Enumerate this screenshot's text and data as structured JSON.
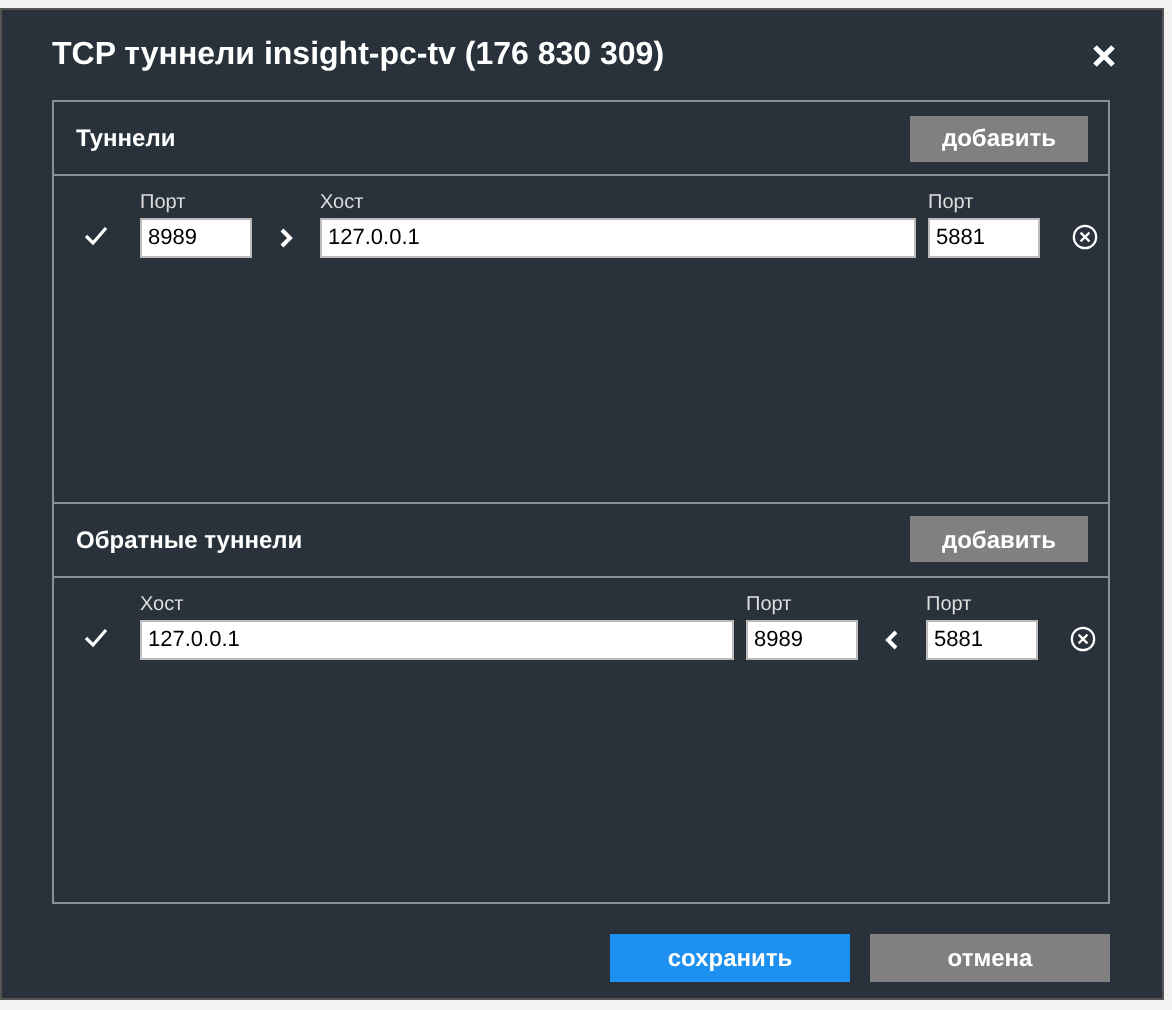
{
  "dialog": {
    "title": "TCP туннели insight-pc-tv (176 830 309)"
  },
  "sections": [
    {
      "title": "Туннели",
      "add_button": "добавить",
      "rows": [
        {
          "checked": true,
          "cells": [
            {
              "kind": "port",
              "label": "Порт",
              "value": "8989"
            },
            {
              "kind": "arrow-right"
            },
            {
              "kind": "host",
              "label": "Хост",
              "value": "127.0.0.1"
            },
            {
              "kind": "port",
              "label": "Порт",
              "value": "5881"
            }
          ]
        }
      ]
    },
    {
      "title": "Обратные туннели",
      "add_button": "добавить",
      "rows": [
        {
          "checked": true,
          "cells": [
            {
              "kind": "host",
              "label": "Хост",
              "value": "127.0.0.1"
            },
            {
              "kind": "port",
              "label": "Порт",
              "value": "8989"
            },
            {
              "kind": "arrow-left"
            },
            {
              "kind": "port",
              "label": "Порт",
              "value": "5881"
            }
          ]
        }
      ]
    }
  ],
  "buttons": [
    {
      "label": "сохранить",
      "kind": "primary"
    },
    {
      "label": "отмена",
      "kind": "secondary"
    }
  ]
}
